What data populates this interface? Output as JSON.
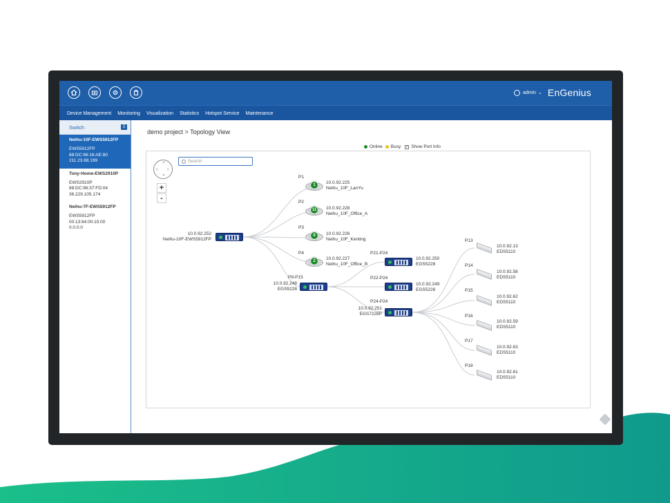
{
  "topbar": {
    "icons": [
      "home-icon",
      "camera-icon",
      "settings-icon",
      "trash-icon"
    ],
    "user": "admin",
    "brand": "EnGenius"
  },
  "nav": {
    "items": [
      "Device Management",
      "Monitoring",
      "Visualization",
      "Statistics",
      "Hotspot Service",
      "Maintenance"
    ]
  },
  "sidebar": {
    "header": "Switch",
    "count": "3",
    "devices": [
      {
        "name": "Neihu-10F-EWS5912FP",
        "model": "EWS5912FP",
        "mac": "88:DC:96:16:AE:80",
        "ip": "211.23.68.199",
        "selected": true
      },
      {
        "name": "Tony-Home-EWS2910P",
        "model": "EWS2910P",
        "mac": "88:DC:96:37:FD:04",
        "ip": "36.229.105.174",
        "selected": false
      },
      {
        "name": "Neihu-7F-EWS5912FP",
        "model": "EWS5912FP",
        "mac": "00:13:64:00:15:00",
        "ip": "0.0.0.0",
        "selected": false
      }
    ]
  },
  "main": {
    "breadcrumb": "demo project > Topology View",
    "legend": {
      "online": "Online",
      "busy": "Busy",
      "show_port_info": "Show Port Info",
      "online_color": "#1d8a2a",
      "busy_color": "#e3c21c"
    },
    "search": {
      "placeholder": "Search"
    },
    "zoom_in": "+",
    "zoom_out": "-"
  },
  "topology": {
    "root": {
      "ip": "10.0.92.252",
      "name": "Neihu-10F-EWS5912FP"
    },
    "aps": [
      {
        "port": "P1",
        "count": "1",
        "ip": "10.0.92.225",
        "name": "Neihu_10F_LanYu"
      },
      {
        "port": "P2",
        "count": "11",
        "ip": "10.0.92.228",
        "name": "Neihu_10F_Office_A"
      },
      {
        "port": "P3",
        "count": "0",
        "ip": "10.0.92.226",
        "name": "Neihu_10F_Kenting"
      },
      {
        "port": "P4",
        "count": "2",
        "ip": "10.0.92.227",
        "name": "Neihu_10F_Office_B"
      }
    ],
    "mid_switch": {
      "port": "P9-P15",
      "ip": "10.0.92.248",
      "model": "EGS5228"
    },
    "switches": [
      {
        "port": "P21-P24",
        "ip": "10.0.92.250",
        "model": "EGS5228"
      },
      {
        "port": "P22-P24",
        "ip": "10.0.92.249",
        "model": "EGS5228"
      },
      {
        "port": "P24-P24",
        "ip": "10.0.92.251",
        "model": "EGS7228P"
      }
    ],
    "cameras": [
      {
        "port": "P13",
        "ip": "10.0.92.13",
        "model": "EDS5110"
      },
      {
        "port": "P14",
        "ip": "10.0.92.58",
        "model": "EDS5110"
      },
      {
        "port": "P15",
        "ip": "10.0.92.62",
        "model": "EDS5110"
      },
      {
        "port": "P16",
        "ip": "10.0.92.59",
        "model": "EDS5110"
      },
      {
        "port": "P17",
        "ip": "10.0.92.63",
        "model": "EDS5110"
      },
      {
        "port": "P18",
        "ip": "10.0.92.61",
        "model": "EDS5110"
      }
    ]
  }
}
